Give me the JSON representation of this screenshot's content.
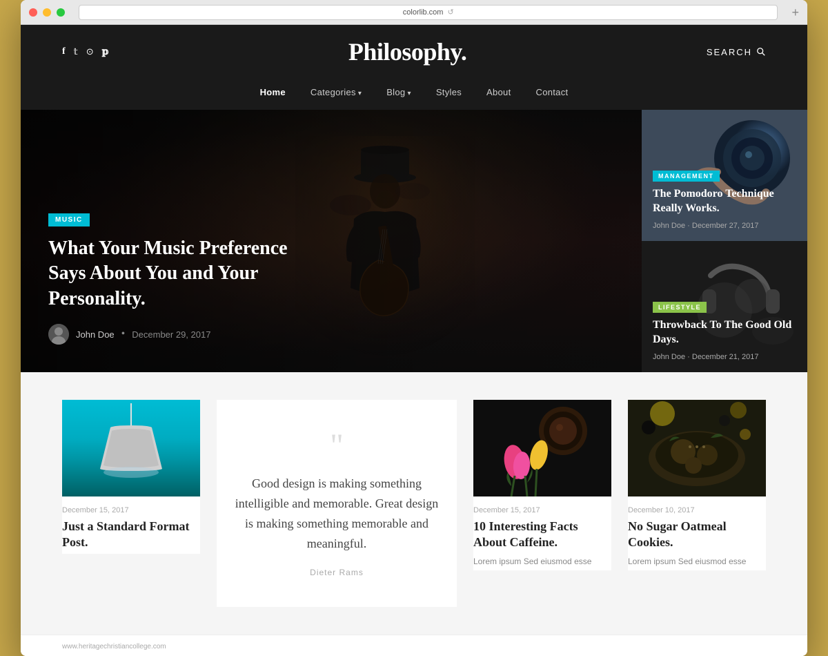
{
  "browser": {
    "url": "colorlib.com",
    "add_button": "+"
  },
  "header": {
    "site_name": "Philosophy.",
    "search_label": "SEARCH",
    "social_icons": [
      "f",
      "𝕏",
      "📷",
      "𝕡"
    ]
  },
  "nav": {
    "items": [
      {
        "label": "Home",
        "active": true,
        "has_arrow": false
      },
      {
        "label": "Categories",
        "active": false,
        "has_arrow": true
      },
      {
        "label": "Blog",
        "active": false,
        "has_arrow": true
      },
      {
        "label": "Styles",
        "active": false,
        "has_arrow": false
      },
      {
        "label": "About",
        "active": false,
        "has_arrow": false
      },
      {
        "label": "Contact",
        "active": false,
        "has_arrow": false
      }
    ]
  },
  "hero": {
    "tag": "MUSIC",
    "title": "What Your Music Preference Says About You and Your Personality.",
    "author": "John Doe",
    "date": "December 29, 2017"
  },
  "side_cards": [
    {
      "tag": "MANAGEMENT",
      "tag_class": "tag-management",
      "title": "The Pomodoro Technique Really Works.",
      "author": "John Doe",
      "date": "December 27, 2017"
    },
    {
      "tag": "LIFESTYLE",
      "tag_class": "tag-lifestyle",
      "title": "Throwback To The Good Old Days.",
      "author": "John Doe",
      "date": "December 21, 2017"
    }
  ],
  "articles": [
    {
      "type": "image",
      "style": "lamp",
      "date": "December 15, 2017",
      "title": "Just a Standard Format Post.",
      "excerpt": ""
    },
    {
      "type": "quote",
      "quote": "Good design is making something intelligible and memorable. Great design is making something memorable and meaningful.",
      "author": "Dieter Rams"
    },
    {
      "type": "image",
      "style": "coffee",
      "date": "December 15, 2017",
      "title": "10 Interesting Facts About Caffeine.",
      "excerpt": "Lorem ipsum Sed eiusmod esse"
    },
    {
      "type": "image",
      "style": "food",
      "date": "December 10, 2017",
      "title": "No Sugar Oatmeal Cookies.",
      "excerpt": "Lorem ipsum Sed eiusmod esse"
    }
  ],
  "footer": {
    "url": "www.heritagechristiancollege.com"
  }
}
